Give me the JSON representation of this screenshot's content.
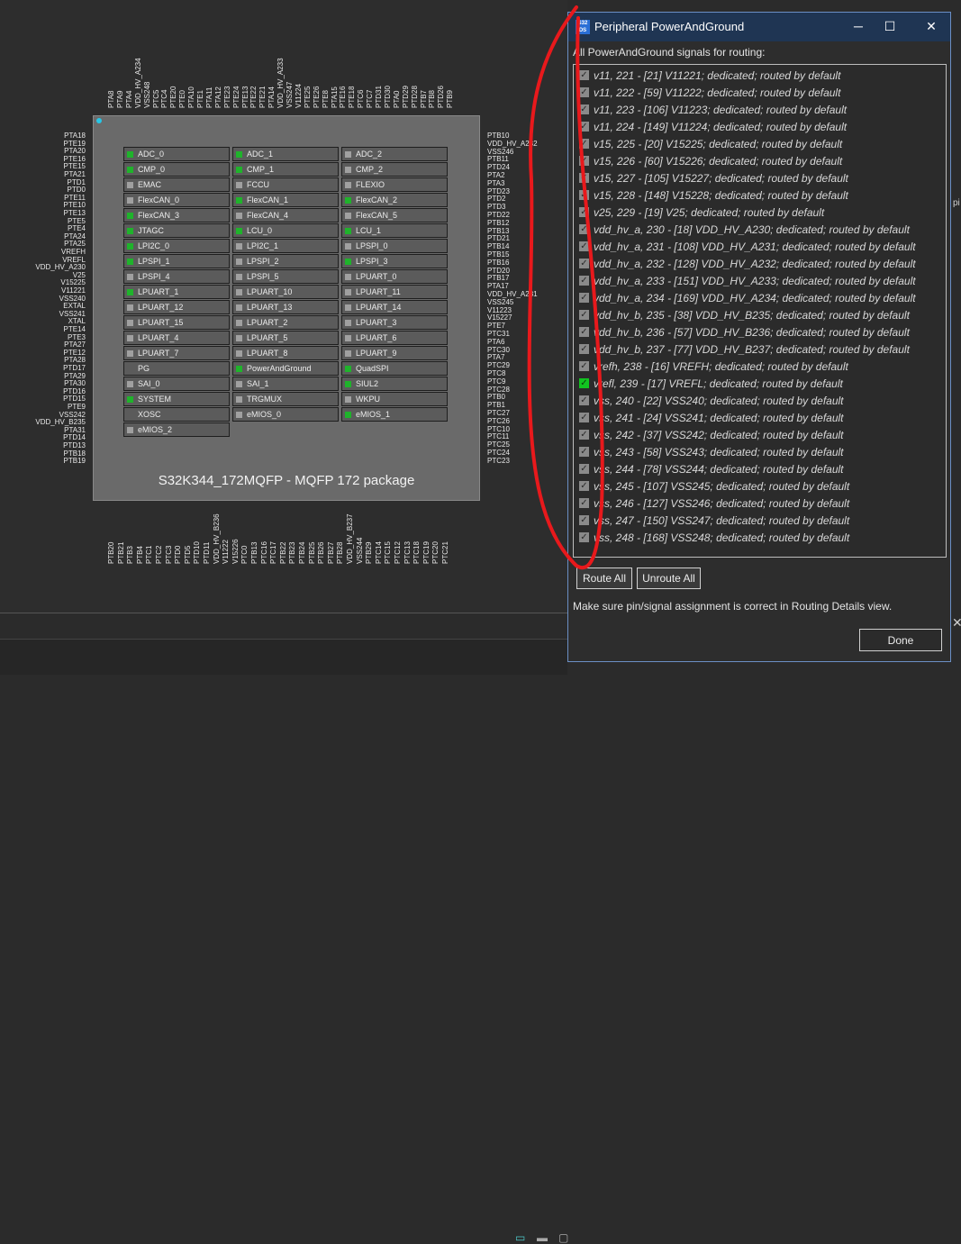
{
  "chip": {
    "title": "S32K344_172MQFP - MQFP 172 package",
    "peripherals": [
      {
        "label": "ADC_0",
        "on": true
      },
      {
        "label": "ADC_1",
        "on": true
      },
      {
        "label": "ADC_2",
        "on": false
      },
      {
        "label": "CMP_0",
        "on": true
      },
      {
        "label": "CMP_1",
        "on": true
      },
      {
        "label": "CMP_2",
        "on": false
      },
      {
        "label": "EMAC",
        "on": false
      },
      {
        "label": "FCCU",
        "on": false
      },
      {
        "label": "FLEXIO",
        "on": false
      },
      {
        "label": "FlexCAN_0",
        "on": false
      },
      {
        "label": "FlexCAN_1",
        "on": true
      },
      {
        "label": "FlexCAN_2",
        "on": true
      },
      {
        "label": "FlexCAN_3",
        "on": true
      },
      {
        "label": "FlexCAN_4",
        "on": false
      },
      {
        "label": "FlexCAN_5",
        "on": false
      },
      {
        "label": "JTAGC",
        "on": true
      },
      {
        "label": "LCU_0",
        "on": true
      },
      {
        "label": "LCU_1",
        "on": true
      },
      {
        "label": "LPI2C_0",
        "on": true
      },
      {
        "label": "LPI2C_1",
        "on": false
      },
      {
        "label": "LPSPI_0",
        "on": false
      },
      {
        "label": "LPSPI_1",
        "on": true
      },
      {
        "label": "LPSPI_2",
        "on": false
      },
      {
        "label": "LPSPI_3",
        "on": true
      },
      {
        "label": "LPSPI_4",
        "on": false
      },
      {
        "label": "LPSPI_5",
        "on": false
      },
      {
        "label": "LPUART_0",
        "on": false
      },
      {
        "label": "LPUART_1",
        "on": true
      },
      {
        "label": "LPUART_10",
        "on": false
      },
      {
        "label": "LPUART_11",
        "on": false
      },
      {
        "label": "LPUART_12",
        "on": false
      },
      {
        "label": "LPUART_13",
        "on": false
      },
      {
        "label": "LPUART_14",
        "on": false
      },
      {
        "label": "LPUART_15",
        "on": false
      },
      {
        "label": "LPUART_2",
        "on": false
      },
      {
        "label": "LPUART_3",
        "on": false
      },
      {
        "label": "LPUART_4",
        "on": false
      },
      {
        "label": "LPUART_5",
        "on": false
      },
      {
        "label": "LPUART_6",
        "on": false
      },
      {
        "label": "LPUART_7",
        "on": false
      },
      {
        "label": "LPUART_8",
        "on": false
      },
      {
        "label": "LPUART_9",
        "on": false
      },
      {
        "label": "PG",
        "on": null
      },
      {
        "label": "PowerAndGround",
        "on": true
      },
      {
        "label": "QuadSPI",
        "on": true
      },
      {
        "label": "SAI_0",
        "on": false
      },
      {
        "label": "SAI_1",
        "on": false
      },
      {
        "label": "SIUL2",
        "on": true
      },
      {
        "label": "SYSTEM",
        "on": true
      },
      {
        "label": "TRGMUX",
        "on": false
      },
      {
        "label": "WKPU",
        "on": false
      },
      {
        "label": "XOSC",
        "on": null
      },
      {
        "label": "eMIOS_0",
        "on": false
      },
      {
        "label": "eMIOS_1",
        "on": true
      },
      {
        "label": "eMIOS_2",
        "on": false
      }
    ],
    "pins_left": [
      "PTA18",
      "PTE19",
      "PTA20",
      "PTE16",
      "PTE15",
      "PTA21",
      "PTD1",
      "PTD0",
      "PTE11",
      "PTE10",
      "PTE13",
      "PTE5",
      "PTE4",
      "PTA24",
      "PTA25",
      "VREFH",
      "VREFL",
      "VDD_HV_A230",
      "V25",
      "V15225",
      "V11221",
      "VSS240",
      "EXTAL",
      "VSS241",
      "XTAL",
      "PTE14",
      "PTE3",
      "PTA27",
      "PTE12",
      "PTA28",
      "PTD17",
      "PTA29",
      "PTA30",
      "PTD16",
      "PTD15",
      "PTE9",
      "VSS242",
      "VDD_HV_B235",
      "PTA31",
      "PTD14",
      "PTD13",
      "PTB18",
      "PTB19"
    ],
    "pins_right": [
      "PTB10",
      "VDD_HV_A232",
      "VSS246",
      "PTB11",
      "PTD24",
      "PTA2",
      "PTA3",
      "PTD23",
      "PTD2",
      "PTD3",
      "PTD22",
      "PTB12",
      "PTB13",
      "PTD21",
      "PTB14",
      "PTB15",
      "PTB16",
      "PTD20",
      "PTB17",
      "PTA17",
      "VDD_HV_A231",
      "VSS245",
      "V11223",
      "V15227",
      "PTE7",
      "PTC31",
      "PTA6",
      "PTC30",
      "PTA7",
      "PTC29",
      "PTC8",
      "PTC9",
      "PTC28",
      "PTB0",
      "PTB1",
      "PTC27",
      "PTC26",
      "PTC10",
      "PTC11",
      "PTC25",
      "PTC24",
      "PTC23"
    ],
    "pins_top": [
      "PTA8",
      "PTA9",
      "PTA4",
      "VDD_HV_A234",
      "VSS248",
      "PTC5",
      "PTC4",
      "PTE20",
      "PTE0",
      "PTA10",
      "PTE1",
      "PTA11",
      "PTA12",
      "PTE23",
      "PTE24",
      "PTE13",
      "PTE22",
      "PTE21",
      "PTA14",
      "VDD_HV_A233",
      "VSS247",
      "V11224",
      "PTE25",
      "PTE26",
      "PTE8",
      "PTA15",
      "PTE16",
      "PTE18",
      "PTC6",
      "PTC7",
      "PTD31",
      "PTD30",
      "PTA0",
      "PTD29",
      "PTD28",
      "PTB7",
      "PTB8",
      "PTD26",
      "PTB9"
    ],
    "pins_bottom": [
      "PTB20",
      "PTB21",
      "PTB3",
      "PTB4",
      "PTC1",
      "PTC2",
      "PTC3",
      "PTD0",
      "PTD5",
      "PTD10",
      "PTD11",
      "VDD_HV_B236",
      "V11222",
      "V15226",
      "PTC0",
      "PTB13",
      "PTC16",
      "PTC17",
      "PTB22",
      "PTB23",
      "PTB24",
      "PTB25",
      "PTB26",
      "PTB27",
      "PTB28",
      "VDD_HV_B237",
      "VSS244",
      "PTB29",
      "PTC14",
      "PTC15",
      "PTC12",
      "PTC13",
      "PTC18",
      "PTC19",
      "PTC20",
      "PTC21"
    ]
  },
  "dialog": {
    "title": "Peripheral PowerAndGround",
    "logo": "S32 DS",
    "minimize": "─",
    "maximize": "☐",
    "close": "✕",
    "instruction": "All PowerAndGround signals for routing:",
    "signals": [
      {
        "text": "v11, 221 - [21] V11221; dedicated; routed by default",
        "active": false
      },
      {
        "text": "v11, 222 - [59] V11222; dedicated; routed by default",
        "active": false
      },
      {
        "text": "v11, 223 - [106] V11223; dedicated; routed by default",
        "active": false
      },
      {
        "text": "v11, 224 - [149] V11224; dedicated; routed by default",
        "active": false
      },
      {
        "text": "v15, 225 - [20] V15225; dedicated; routed by default",
        "active": false
      },
      {
        "text": "v15, 226 - [60] V15226; dedicated; routed by default",
        "active": false
      },
      {
        "text": "v15, 227 - [105] V15227; dedicated; routed by default",
        "active": false
      },
      {
        "text": "v15, 228 - [148] V15228; dedicated; routed by default",
        "active": false
      },
      {
        "text": "v25, 229 - [19] V25; dedicated; routed by default",
        "active": false
      },
      {
        "text": "vdd_hv_a, 230 - [18] VDD_HV_A230; dedicated; routed by default",
        "active": false
      },
      {
        "text": "vdd_hv_a, 231 - [108] VDD_HV_A231; dedicated; routed by default",
        "active": false
      },
      {
        "text": "vdd_hv_a, 232 - [128] VDD_HV_A232; dedicated; routed by default",
        "active": false
      },
      {
        "text": "vdd_hv_a, 233 - [151] VDD_HV_A233; dedicated; routed by default",
        "active": false
      },
      {
        "text": "vdd_hv_a, 234 - [169] VDD_HV_A234; dedicated; routed by default",
        "active": false
      },
      {
        "text": "vdd_hv_b, 235 - [38] VDD_HV_B235; dedicated; routed by default",
        "active": false
      },
      {
        "text": "vdd_hv_b, 236 - [57] VDD_HV_B236; dedicated; routed by default",
        "active": false
      },
      {
        "text": "vdd_hv_b, 237 - [77] VDD_HV_B237; dedicated; routed by default",
        "active": false
      },
      {
        "text": "vrefh, 238 - [16] VREFH; dedicated; routed by default",
        "active": false
      },
      {
        "text": "vrefl, 239 - [17] VREFL; dedicated; routed by default",
        "active": true
      },
      {
        "text": "vss, 240 - [22] VSS240; dedicated; routed by default",
        "active": false
      },
      {
        "text": "vss, 241 - [24] VSS241; dedicated; routed by default",
        "active": false
      },
      {
        "text": "vss, 242 - [37] VSS242; dedicated; routed by default",
        "active": false
      },
      {
        "text": "vss, 243 - [58] VSS243; dedicated; routed by default",
        "active": false
      },
      {
        "text": "vss, 244 - [78] VSS244; dedicated; routed by default",
        "active": false
      },
      {
        "text": "vss, 245 - [107] VSS245; dedicated; routed by default",
        "active": false
      },
      {
        "text": "vss, 246 - [127] VSS246; dedicated; routed by default",
        "active": false
      },
      {
        "text": "vss, 247 - [150] VSS247; dedicated; routed by default",
        "active": false
      },
      {
        "text": "vss, 248 - [168] VSS248; dedicated; routed by default",
        "active": false
      }
    ],
    "route_all": "Route All",
    "unroute_all": "Unroute All",
    "note": "Make sure pin/signal assignment is correct in Routing Details view.",
    "done": "Done"
  },
  "side_hint": "pi",
  "side_close": "✕",
  "colors": {
    "annotation": "#e8191c",
    "active_check": "#11c320",
    "peripheral_on": "#1fb32b",
    "title_bar": "#1f3553"
  }
}
